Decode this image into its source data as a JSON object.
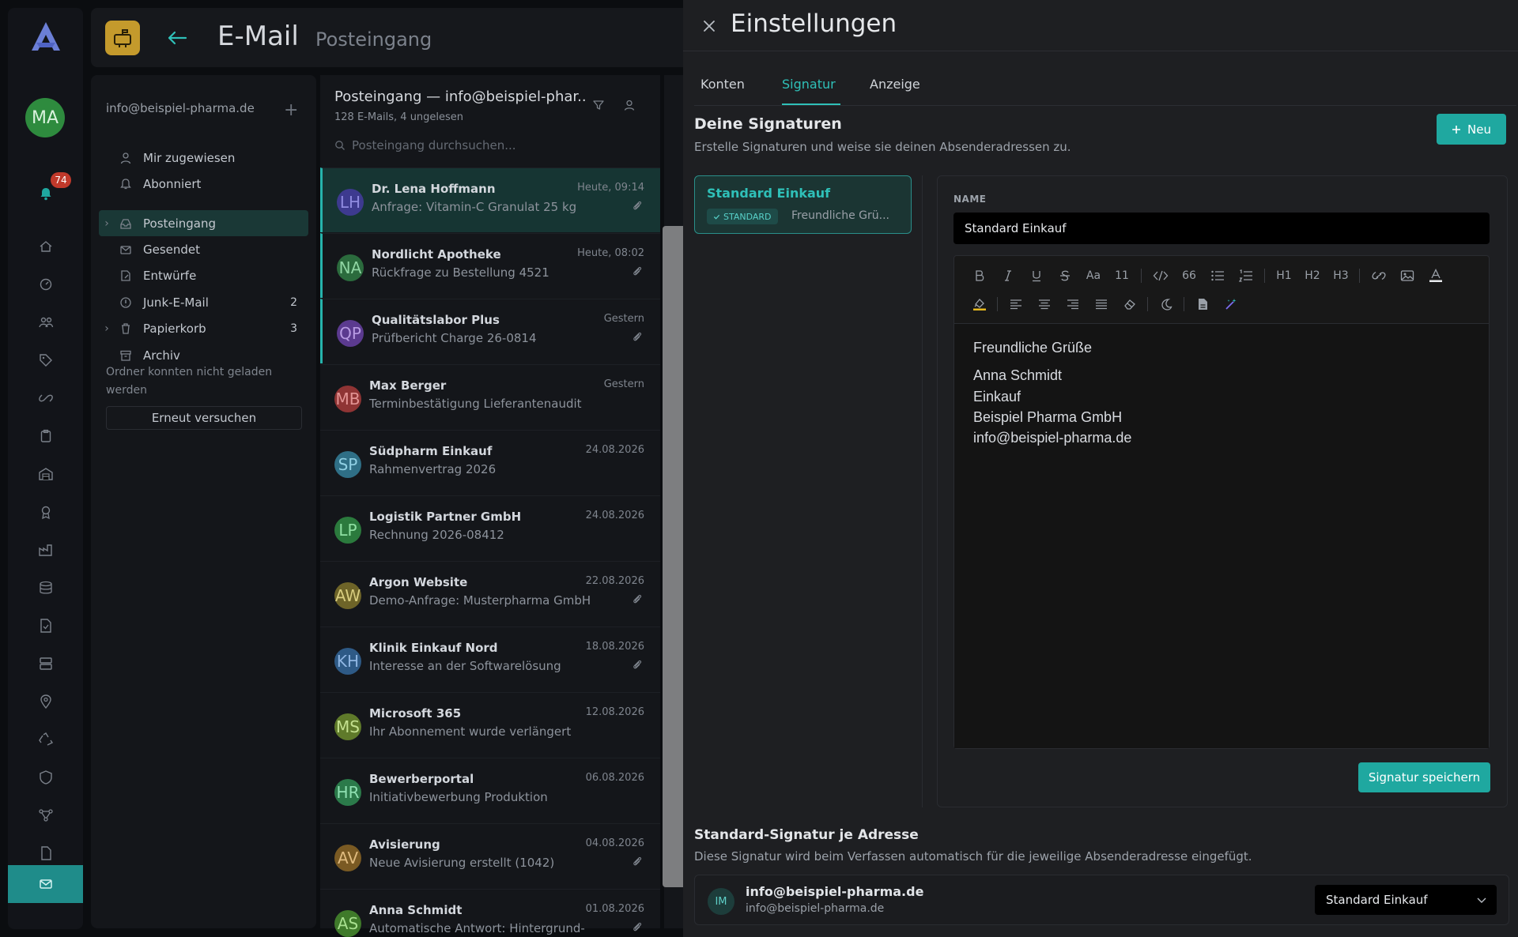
{
  "rail": {
    "avatar_initials": "MA",
    "notification_count": "74",
    "icons": [
      "home-icon",
      "dashboard-icon",
      "users-icon",
      "tag-icon",
      "link-icon",
      "clipboard-icon",
      "warehouse-icon",
      "award-icon",
      "factory-icon",
      "stack-icon",
      "document-check-icon",
      "server-icon",
      "location-icon",
      "recycle-icon",
      "shield-icon",
      "network-icon",
      "file-icon",
      "mail-icon"
    ]
  },
  "header": {
    "title": "E-Mail",
    "subtitle": "Posteingang"
  },
  "folders": {
    "account": "info@beispiel-pharma.de",
    "items": [
      {
        "label": "Mir zugewiesen",
        "count": "",
        "icon": "user-icon",
        "chevron": false
      },
      {
        "label": "Abonniert",
        "count": "",
        "icon": "bell-icon",
        "chevron": false
      },
      {
        "label": "Posteingang",
        "count": "",
        "icon": "inbox-icon",
        "chevron": true,
        "selected": true
      },
      {
        "label": "Gesendet",
        "count": "",
        "icon": "sent-icon",
        "chevron": false
      },
      {
        "label": "Entwürfe",
        "count": "",
        "icon": "draft-icon",
        "chevron": false
      },
      {
        "label": "Junk-E-Mail",
        "count": "2",
        "icon": "junk-icon",
        "chevron": false
      },
      {
        "label": "Papierkorb",
        "count": "3",
        "icon": "trash-icon",
        "chevron": true
      },
      {
        "label": "Archiv",
        "count": "",
        "icon": "archive-icon",
        "chevron": false
      }
    ],
    "error_text": "Ordner konnten nicht geladen werden",
    "retry_label": "Erneut versuchen"
  },
  "list": {
    "title": "Posteingang — info@beispiel-phar...",
    "count_text": "128 E-Mails, 4 ungelesen",
    "search_placeholder": "Posteingang durchsuchen...",
    "mails": [
      {
        "initials": "LH",
        "color": "#3d3a8f",
        "text": "#8f8be0",
        "from": "Dr. Lena Hoffmann",
        "subject": "Anfrage: Vitamin-C Granulat 25 kg",
        "date": "Heute, 09:14",
        "attachment": true,
        "state": "active"
      },
      {
        "initials": "NA",
        "color": "#2b6b3d",
        "text": "#8fd5a2",
        "from": "Nordlicht Apotheke",
        "subject": "Rückfrage zu Bestellung 4521",
        "date": "Heute, 08:02",
        "attachment": true,
        "state": "unread"
      },
      {
        "initials": "QP",
        "color": "#5b3a8f",
        "text": "#b89be3",
        "from": "Qualitätslabor Plus",
        "subject": "Prüfbericht Charge 26-0814",
        "date": "Gestern",
        "attachment": true,
        "state": "unread"
      },
      {
        "initials": "MB",
        "color": "#8f3434",
        "text": "#e39494",
        "from": "Max Berger",
        "subject": "Terminbestätigung Lieferantenaudit",
        "date": "Gestern",
        "attachment": false,
        "state": ""
      },
      {
        "initials": "SP",
        "color": "#2f6f86",
        "text": "#8fcfe3",
        "from": "Südpharm Einkauf",
        "subject": "Rahmenvertrag 2026",
        "date": "24.08.2026",
        "attachment": false,
        "state": ""
      },
      {
        "initials": "LP",
        "color": "#2b7a3d",
        "text": "#8fe0a2",
        "from": "Logistik Partner GmbH",
        "subject": "Rechnung 2026-08412",
        "date": "24.08.2026",
        "attachment": false,
        "state": ""
      },
      {
        "initials": "AW",
        "color": "#6e6428",
        "text": "#d8cd7f",
        "from": "Argon Website",
        "subject": "Demo-Anfrage: Musterpharma GmbH",
        "date": "22.08.2026",
        "attachment": true,
        "state": ""
      },
      {
        "initials": "KH",
        "color": "#2e5a86",
        "text": "#8fb6e3",
        "from": "Klinik Einkauf Nord",
        "subject": "Interesse an der Softwarelösung",
        "date": "18.08.2026",
        "attachment": true,
        "state": ""
      },
      {
        "initials": "MS",
        "color": "#5f7a2a",
        "text": "#c4e08f",
        "from": "Microsoft 365",
        "subject": "Ihr Abonnement wurde verlängert",
        "date": "12.08.2026",
        "attachment": false,
        "state": ""
      },
      {
        "initials": "HR",
        "color": "#2b7a4a",
        "text": "#8fe0b2",
        "from": "Bewerberportal",
        "subject": "Initiativbewerbung Produktion",
        "date": "06.08.2026",
        "attachment": false,
        "state": ""
      },
      {
        "initials": "AV",
        "color": "#7a5a23",
        "text": "#e0bb7f",
        "from": "Avisierung",
        "subject": "Neue Avisierung erstellt (1042)",
        "date": "04.08.2026",
        "attachment": true,
        "state": ""
      },
      {
        "initials": "AS",
        "color": "#3f7a2a",
        "text": "#a8e08f",
        "from": "Anna Schmidt",
        "subject": "Automatische Antwort: Hintergrund-",
        "date": "01.08.2026",
        "attachment": true,
        "state": ""
      }
    ]
  },
  "settings": {
    "title": "Einstellungen",
    "tabs": [
      "Konten",
      "Signatur",
      "Anzeige"
    ],
    "active_tab": "Signatur",
    "section_title": "Deine Signaturen",
    "section_desc": "Erstelle Signaturen und weise sie deinen Absenderadressen zu.",
    "new_label": "Neu",
    "signature_card": {
      "name": "Standard Einkauf",
      "badge": "STANDARD",
      "preview": "Freundliche Grü..."
    },
    "editor": {
      "name_label": "NAME",
      "name_value": "Standard Einkauf",
      "toolbar_text": {
        "font_size_label": "Aa",
        "font_size_value": "11",
        "quote": "66",
        "h1": "H1",
        "h2": "H2",
        "h3": "H3"
      },
      "body_lines": [
        "Freundliche Grüße",
        "Anna Schmidt",
        "Einkauf",
        "Beispiel Pharma GmbH",
        "info@beispiel-pharma.de"
      ],
      "save_label": "Signatur speichern"
    },
    "default_section_title": "Standard-Signatur je Adresse",
    "default_section_desc": "Diese Signatur wird beim Verfassen automatisch für die jeweilige Absenderadresse eingefügt.",
    "address_row": {
      "initials": "IM",
      "address": "info@beispiel-pharma.de",
      "address_sub": "info@beispiel-pharma.de",
      "selected_signature": "Standard Einkauf"
    }
  },
  "colors": {
    "accent": "#1fa8a0",
    "accent_text": "#2fc0b8",
    "background": "#0b0d10",
    "panel": "#1e1f22",
    "badge": "#c0392b",
    "app_icon": "#c49a2c"
  }
}
